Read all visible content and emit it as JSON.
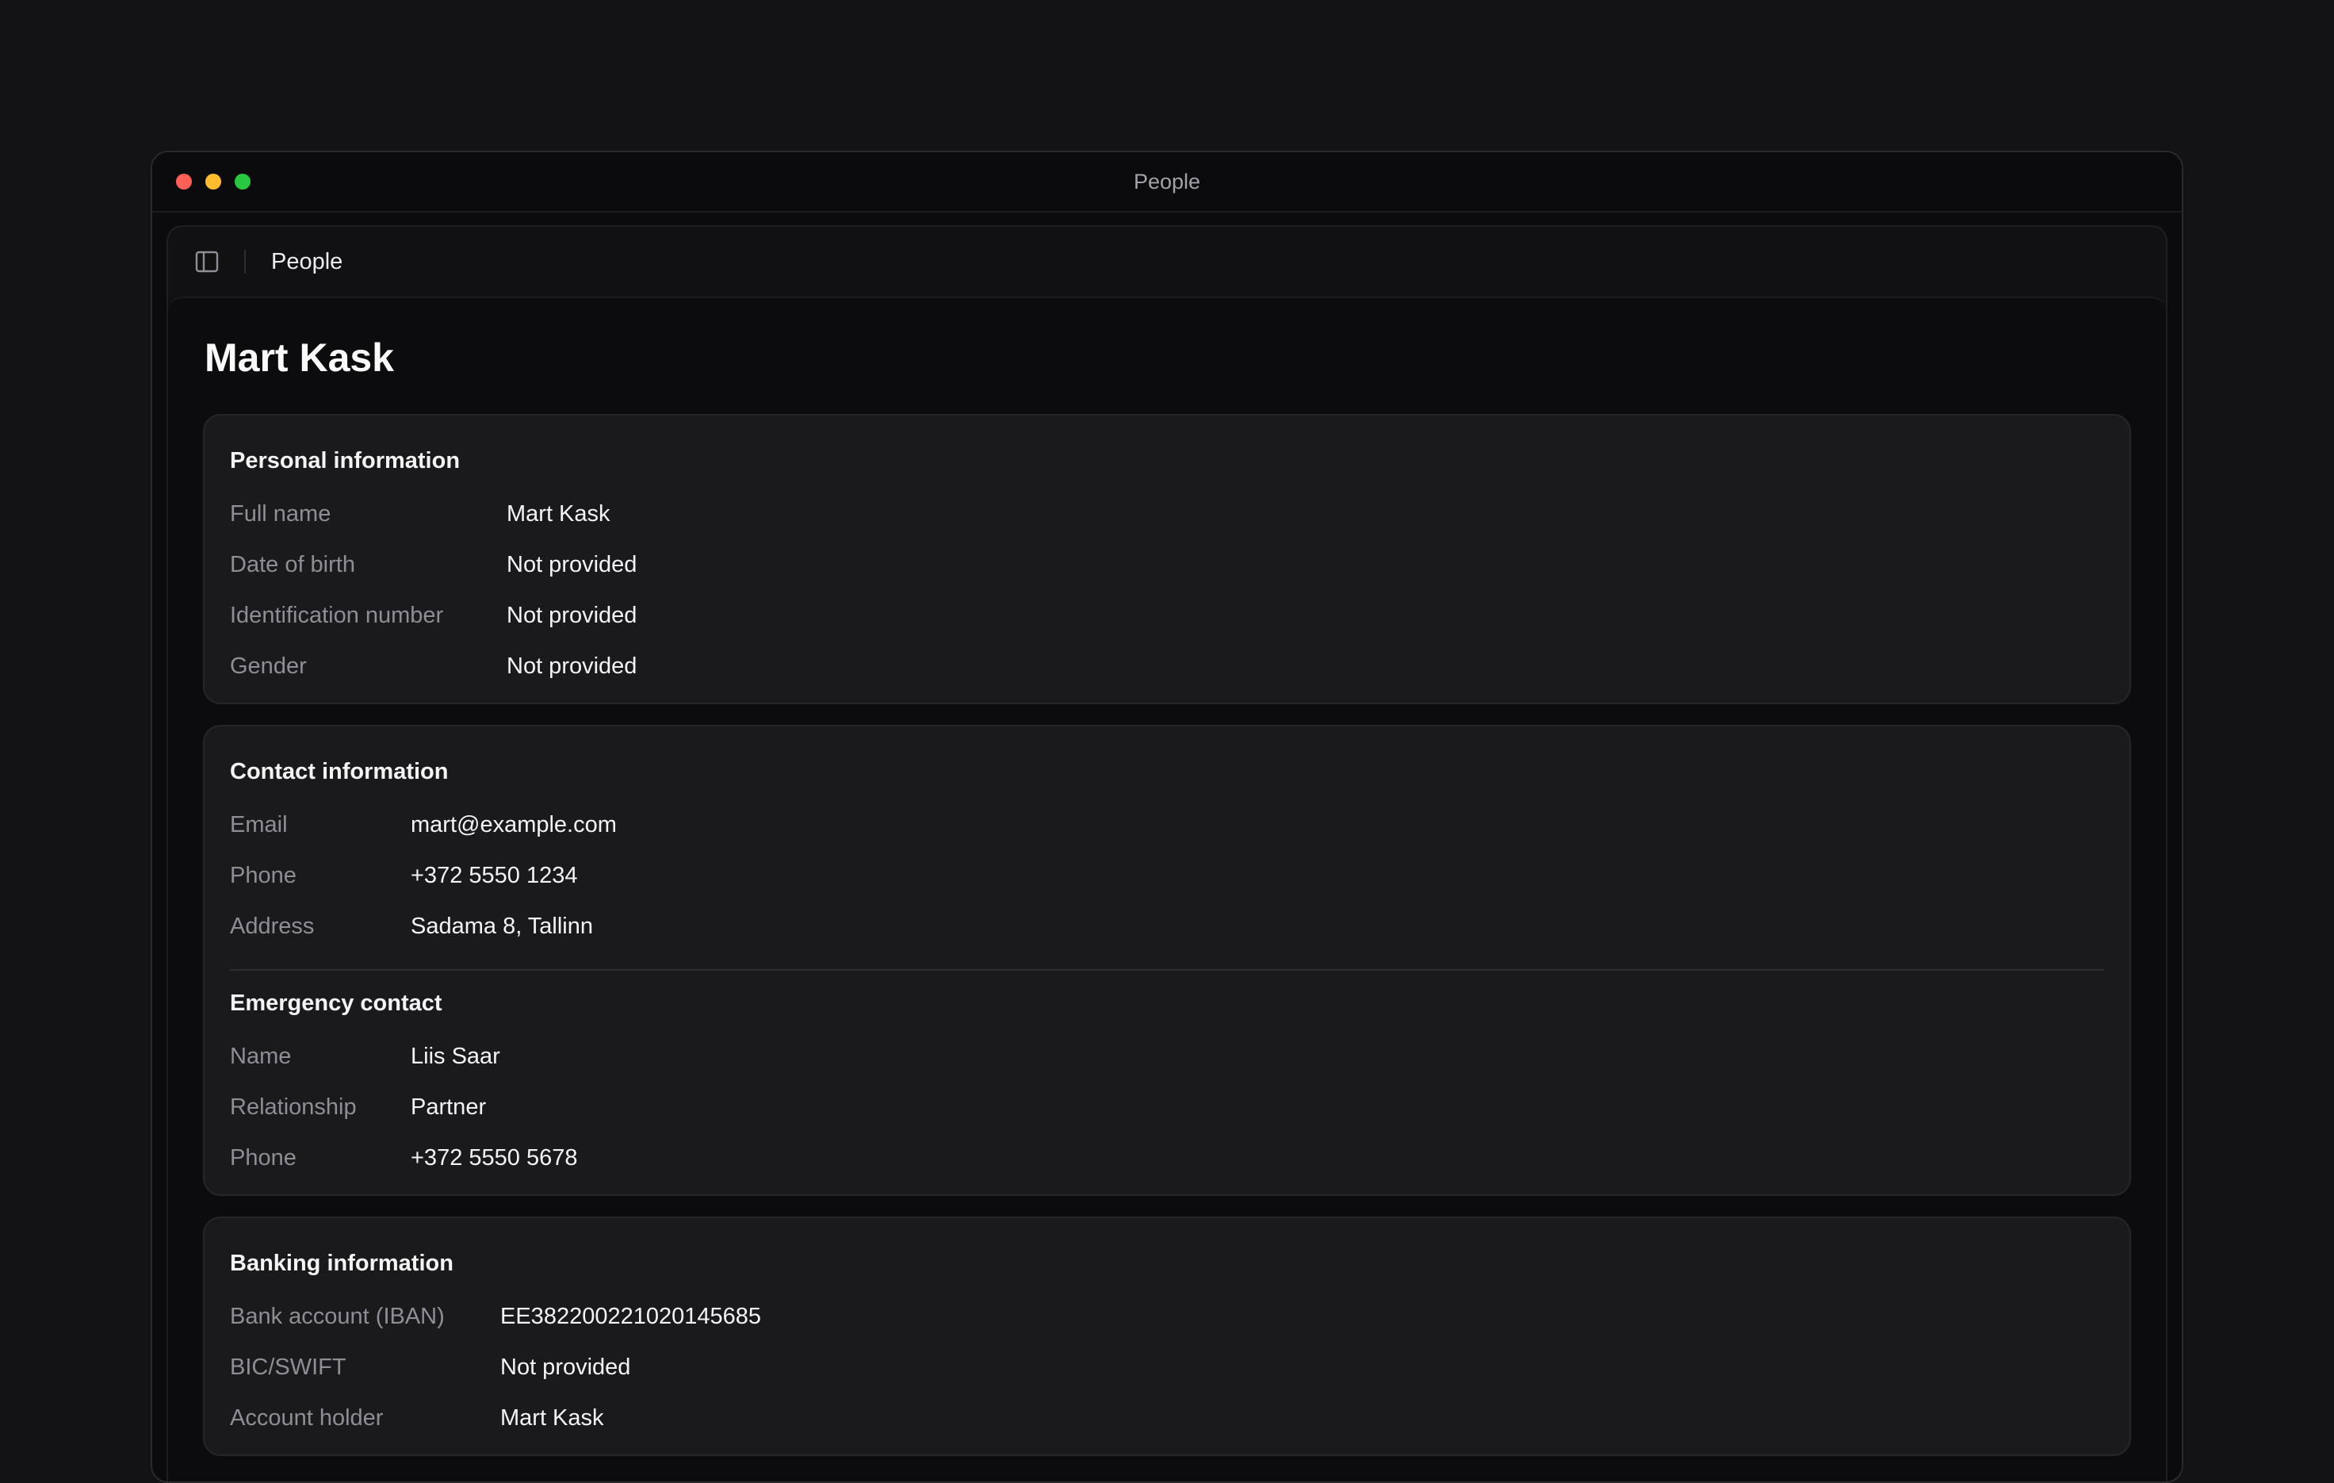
{
  "window": {
    "title": "People"
  },
  "topbar": {
    "breadcrumb": "People"
  },
  "page": {
    "title": "Mart Kask"
  },
  "personal": {
    "title": "Personal information",
    "fields": [
      {
        "label": "Full name",
        "value": "Mart Kask"
      },
      {
        "label": "Date of birth",
        "value": "Not provided"
      },
      {
        "label": "Identification number",
        "value": "Not provided"
      },
      {
        "label": "Gender",
        "value": "Not provided"
      }
    ]
  },
  "contact": {
    "title": "Contact information",
    "fields": [
      {
        "label": "Email",
        "value": "mart@example.com"
      },
      {
        "label": "Phone",
        "value": "+372 5550 1234"
      },
      {
        "label": "Address",
        "value": "Sadama 8, Tallinn"
      }
    ],
    "emergency": {
      "title": "Emergency contact",
      "fields": [
        {
          "label": "Name",
          "value": "Liis Saar"
        },
        {
          "label": "Relationship",
          "value": "Partner"
        },
        {
          "label": "Phone",
          "value": "+372 5550 5678"
        }
      ]
    }
  },
  "banking": {
    "title": "Banking information",
    "fields": [
      {
        "label": "Bank account (IBAN)",
        "value": "EE382200221020145685"
      },
      {
        "label": "BIC/SWIFT",
        "value": "Not provided"
      },
      {
        "label": "Account holder",
        "value": "Mart Kask"
      }
    ]
  },
  "icons": {
    "sidebar_toggle": "sidebar-toggle-icon"
  },
  "colors": {
    "background": "#131316",
    "card": "#1a1a1d",
    "label": "#8e8e96",
    "value": "#f4f4f5"
  }
}
